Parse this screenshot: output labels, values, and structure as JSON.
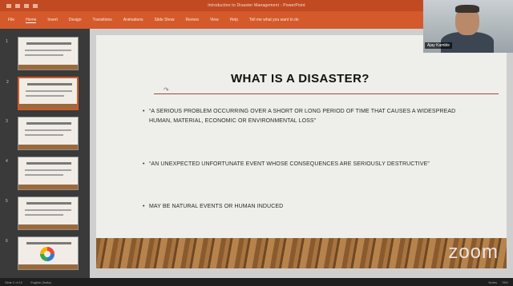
{
  "window": {
    "title": "Introduction to Disaster Management - PowerPoint"
  },
  "ribbon": {
    "tabs": [
      "File",
      "Home",
      "Insert",
      "Design",
      "Transitions",
      "Animations",
      "Slide Show",
      "Review",
      "View",
      "Help",
      "Tell me what you want to do"
    ]
  },
  "thumbnails": [
    {
      "num": "1",
      "selected": false,
      "type": "title"
    },
    {
      "num": "2",
      "selected": true,
      "type": "text"
    },
    {
      "num": "3",
      "selected": false,
      "type": "text"
    },
    {
      "num": "4",
      "selected": false,
      "type": "text"
    },
    {
      "num": "5",
      "selected": false,
      "type": "text"
    },
    {
      "num": "6",
      "selected": false,
      "type": "diagram"
    }
  ],
  "slide": {
    "title": "WHAT IS A DISASTER?",
    "bullets": [
      "“A SERIOUS PROBLEM OCCURRING OVER A SHORT OR LONG PERIOD OF TIME THAT CAUSES A WIDESPREAD HUMAN, MATERIAL, ECONOMIC OR ENVIRONMENTAL LOSS”",
      "“AN UNEXPECTED UNFORTUNATE EVENT WHOSE CONSEQUENCES ARE SERIOUSLY DESTRUCTIVE”",
      "MAY BE NATURAL EVENTS OR HUMAN INDUCED"
    ],
    "watermark": "zoom"
  },
  "webcam": {
    "name": "Ajay Kamble"
  },
  "statusbar": {
    "slide_info": "Slide 2 of 12",
    "language": "English (India)",
    "notes": "Notes",
    "zoom": "78%"
  },
  "colors": {
    "ribbon": "#c24a22",
    "accent_rule": "#9e4b3a"
  }
}
